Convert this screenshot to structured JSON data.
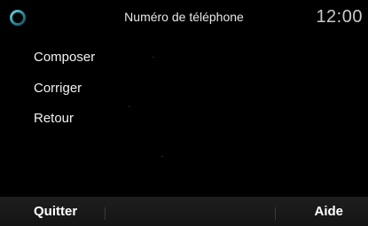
{
  "header": {
    "title": "Numéro de téléphone",
    "clock": "12:00",
    "logo_icon": "app-ring-logo-icon"
  },
  "menu": {
    "items": [
      {
        "label": "Composer"
      },
      {
        "label": "Corriger"
      },
      {
        "label": "Retour"
      }
    ]
  },
  "footer": {
    "left_label": "Quitter",
    "right_label": "Aide"
  },
  "colors": {
    "background": "#000000",
    "footer_bar": "#161616",
    "logo_accent": "#3aa9b8",
    "text": "#ffffff"
  }
}
